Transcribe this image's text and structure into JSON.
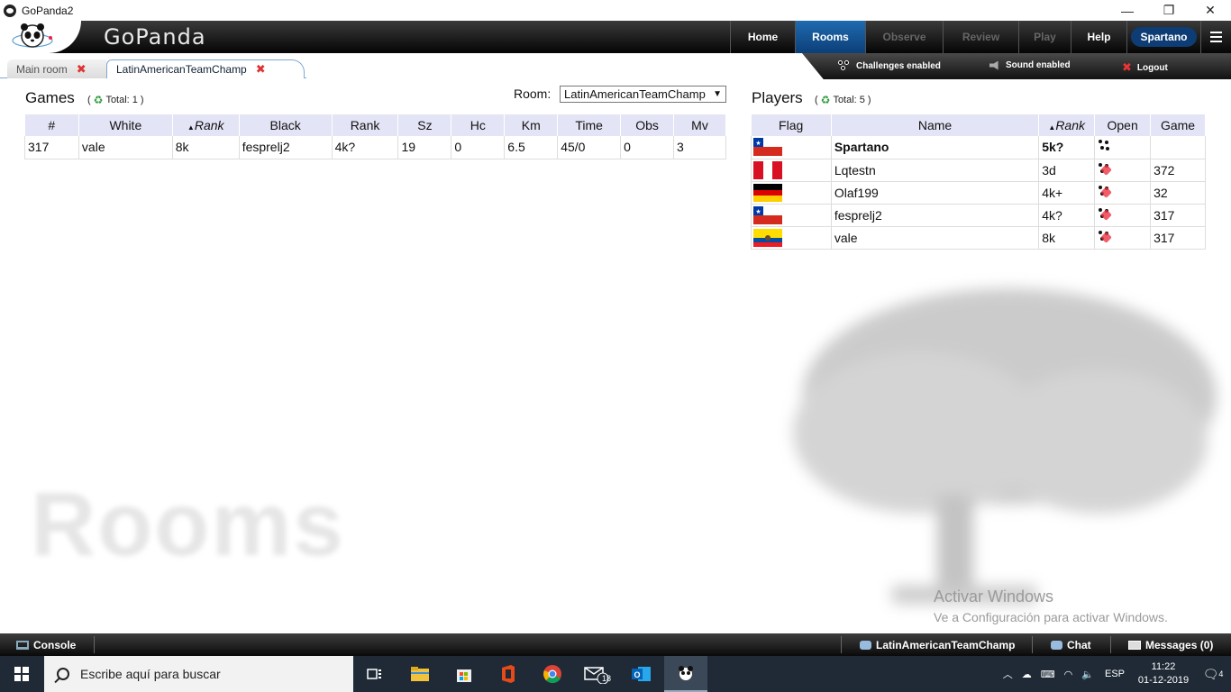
{
  "window": {
    "title": "GoPanda2",
    "controls": [
      "—",
      "❐",
      "✕"
    ]
  },
  "app": {
    "brand": "GoPanda",
    "nav": [
      {
        "label": "Home",
        "state": "normal"
      },
      {
        "label": "Rooms",
        "state": "active"
      },
      {
        "label": "Observe",
        "state": "disabled"
      },
      {
        "label": "Review",
        "state": "disabled"
      },
      {
        "label": "Play",
        "state": "disabled"
      },
      {
        "label": "Help",
        "state": "normal"
      }
    ],
    "user": "Spartano"
  },
  "tabs": [
    {
      "label": "Main room"
    },
    {
      "label": "LatinAmericanTeamChamp"
    }
  ],
  "status": {
    "challenges": "Challenges enabled",
    "sound": "Sound enabled",
    "logout": "Logout"
  },
  "games": {
    "title": "Games",
    "total": "Total: 1",
    "room_label": "Room:",
    "room_value": "LatinAmericanTeamChamp",
    "columns": [
      "#",
      "White",
      "Rank",
      "Black",
      "Rank",
      "Sz",
      "Hc",
      "Km",
      "Time",
      "Obs",
      "Mv"
    ],
    "rows": [
      [
        "317",
        "vale",
        "8k",
        "fesprelj2",
        "4k?",
        "19",
        "0",
        "6.5",
        "45/0",
        "0",
        "3"
      ]
    ]
  },
  "players": {
    "title": "Players",
    "total": "Total: 5",
    "columns": [
      "Flag",
      "Name",
      "Rank",
      "Open",
      "Game"
    ],
    "rows": [
      {
        "flag": "chile",
        "name": "Spartano",
        "rank": "5k?",
        "open": "stones",
        "game": "",
        "bold": true
      },
      {
        "flag": "peru",
        "name": "Lqtestn",
        "rank": "3d",
        "open": "stones-red",
        "game": "372"
      },
      {
        "flag": "germany",
        "name": "Olaf199",
        "rank": "4k+",
        "open": "stones-red",
        "game": "32"
      },
      {
        "flag": "chile",
        "name": "fesprelj2",
        "rank": "4k?",
        "open": "stones-red",
        "game": "317"
      },
      {
        "flag": "ecuador",
        "name": "vale",
        "rank": "8k",
        "open": "stones-red",
        "game": "317"
      }
    ]
  },
  "watermark": "Rooms",
  "activate": {
    "line1": "Activar Windows",
    "line2": "Ve a Configuración para activar Windows."
  },
  "bottom": {
    "console": "Console",
    "room": "LatinAmericanTeamChamp",
    "chat": "Chat",
    "messages": "Messages (0)"
  },
  "taskbar": {
    "search_placeholder": "Escribe aquí para buscar",
    "mail_badge": "18",
    "lang": "ESP",
    "time": "11:22",
    "date": "01-12-2019",
    "notifications": "4"
  }
}
